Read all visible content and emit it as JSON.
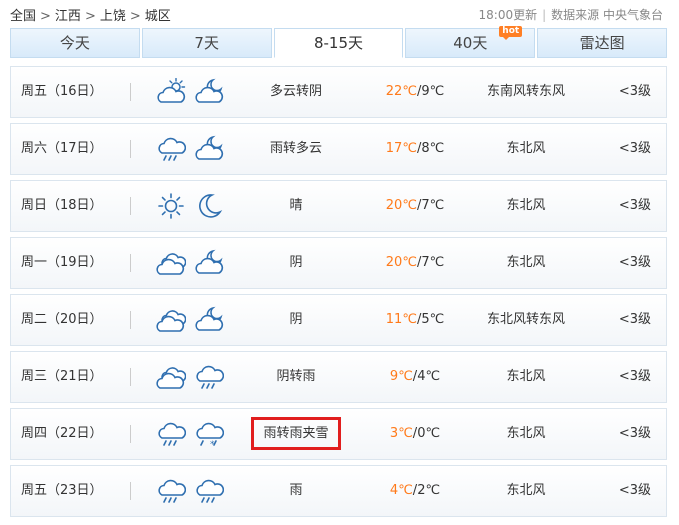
{
  "breadcrumb": {
    "items": [
      "全国",
      "江西",
      "上饶",
      "城区"
    ],
    "sep": ">"
  },
  "meta": {
    "update": "18:00更新",
    "source": "数据来源 中央气象台"
  },
  "tabs": [
    {
      "label": "今天"
    },
    {
      "label": "7天"
    },
    {
      "label": "8-15天",
      "active": true
    },
    {
      "label": "40天",
      "badge": "hot"
    },
    {
      "label": "雷达图"
    }
  ],
  "forecast": [
    {
      "day": "周五（16日）",
      "icon_day": "cloudy-sun-icon",
      "icon_night": "cloudy-moon-icon",
      "desc": "多云转阴",
      "high": "22℃",
      "low": "9℃",
      "wind": "东南风转东风",
      "level": "<3级"
    },
    {
      "day": "周六（17日）",
      "icon_day": "rain-icon",
      "icon_night": "cloudy-moon-icon",
      "desc": "雨转多云",
      "high": "17℃",
      "low": "8℃",
      "wind": "东北风",
      "level": "<3级"
    },
    {
      "day": "周日（18日）",
      "icon_day": "sun-icon",
      "icon_night": "moon-icon",
      "desc": "晴",
      "high": "20℃",
      "low": "7℃",
      "wind": "东北风",
      "level": "<3级"
    },
    {
      "day": "周一（19日）",
      "icon_day": "overcast-icon",
      "icon_night": "cloudy-moon-icon",
      "desc": "阴",
      "high": "20℃",
      "low": "7℃",
      "wind": "东北风",
      "level": "<3级"
    },
    {
      "day": "周二（20日）",
      "icon_day": "overcast-icon",
      "icon_night": "cloudy-moon-icon",
      "desc": "阴",
      "high": "11℃",
      "low": "5℃",
      "wind": "东北风转东风",
      "level": "<3级"
    },
    {
      "day": "周三（21日）",
      "icon_day": "overcast-icon",
      "icon_night": "rain-icon",
      "desc": "阴转雨",
      "high": "9℃",
      "low": "4℃",
      "wind": "东北风",
      "level": "<3级"
    },
    {
      "day": "周四（22日）",
      "icon_day": "rain-icon",
      "icon_night": "sleet-icon",
      "desc": "雨转雨夹雪",
      "high": "3℃",
      "low": "0℃",
      "wind": "东北风",
      "level": "<3级",
      "highlighted": true
    },
    {
      "day": "周五（23日）",
      "icon_day": "rain-icon",
      "icon_night": "rain-icon",
      "desc": "雨",
      "high": "4℃",
      "low": "2℃",
      "wind": "东北风",
      "level": "<3级"
    }
  ],
  "colors": {
    "accent": "#ff7a1a",
    "tab_bg": "#d8eafa",
    "highlight": "#e11e1e",
    "icon": "#2f6fb0"
  }
}
